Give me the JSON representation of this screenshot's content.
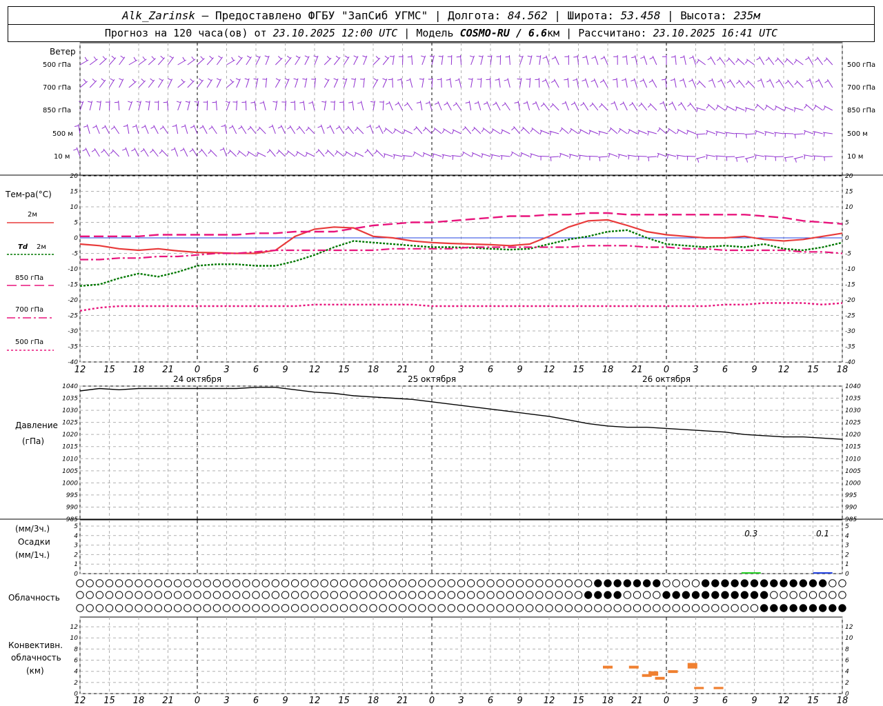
{
  "header": {
    "station": "Alk_Zarinsk",
    "provider": " – Предоставлено ФГБУ \"ЗапСиб УГМС\"",
    "lon_label": "Долгота:",
    "lon": "84.562",
    "lat_label": "Широта:",
    "lat": "53.458",
    "alt_label": "Высота:",
    "alt": "235м",
    "forecast_prefix": "Прогноз на 120 часа(ов) от",
    "forecast_time": "23.10.2025 12:00 UTC",
    "model_label": "Модель",
    "model": "COSMO-RU / 6.6",
    "model_unit": "км",
    "calc_label": "Рассчитано:",
    "calc_time": "23.10.2025 16:41 UTC"
  },
  "labels": {
    "wind": "Ветер",
    "wind_levels": [
      "500 гПа",
      "700 гПа",
      "850 гПа",
      "500 м",
      "10  м"
    ],
    "temp_title": "Тем-ра(°C)",
    "t2m": "2м",
    "td2m_a": "Td",
    "td2m_b": "2м",
    "t850": "850 гПа",
    "t700": "700 гПа",
    "t500": "500 гПа",
    "pressure_a": "Давление",
    "pressure_b": "(гПа)",
    "precip_a": "(мм/3ч.)",
    "precip_b": "Осадки",
    "precip_c": "(мм/1ч.)",
    "cloud": "Облачность",
    "conv_a": "Конвективн.",
    "conv_b": "облачность",
    "conv_c": "(км)"
  },
  "colors": {
    "t2m": "#e83a3a",
    "td2m": "#007800",
    "t850": "#e8147c",
    "t700": "#e8147c",
    "t500": "#e8147c",
    "wind": "#9030d0",
    "pressure": "#000000",
    "precip_3h": "#20cc20",
    "precip_1h": "#2040e0",
    "conv": "#f08030",
    "grid": "#b0b0b0"
  },
  "chart_data": {
    "type": "line",
    "time_ticks": [
      "12",
      "15",
      "18",
      "21",
      "0",
      "3",
      "6",
      "9",
      "12",
      "15",
      "18",
      "21",
      "0",
      "3",
      "6",
      "9",
      "12",
      "15",
      "18",
      "21",
      "0",
      "3",
      "6",
      "9",
      "12",
      "15",
      "18"
    ],
    "date_labels": [
      "24 октября",
      "25 октября",
      "26 октября"
    ],
    "temperature": {
      "ylim": [
        -40,
        20
      ],
      "ticks": [
        20,
        15,
        10,
        5,
        0,
        -5,
        -10,
        -15,
        -20,
        -25,
        -30,
        -35,
        -40
      ],
      "hours": [
        0,
        3,
        6,
        9,
        12,
        15,
        18,
        21,
        24,
        27,
        30,
        33,
        36,
        39,
        42,
        45,
        48,
        51,
        54,
        57,
        60,
        63,
        66,
        69,
        72,
        75,
        78,
        81,
        84,
        87,
        90,
        93,
        96,
        99,
        102,
        105,
        108,
        111,
        114,
        117
      ],
      "series": [
        {
          "name": "2м",
          "values": [
            -2,
            -2.5,
            -3.5,
            -4,
            -3.5,
            -4.2,
            -4.7,
            -4.8,
            -5,
            -5,
            -4,
            0.5,
            2.8,
            3.5,
            3.2,
            0.5,
            0,
            -1,
            -1.5,
            -1.8,
            -2,
            -2.2,
            -2.5,
            -2,
            0.5,
            3.5,
            5.5,
            5.8,
            4,
            2,
            1,
            0.5,
            0,
            0,
            0.5,
            -0.5,
            -1,
            -0.5,
            0.5,
            1.5
          ]
        },
        {
          "name": "Td 2м",
          "values": [
            -15.5,
            -15,
            -13,
            -11.5,
            -12.5,
            -11,
            -9,
            -8.5,
            -8.5,
            -9,
            -9,
            -7.5,
            -5.5,
            -3,
            -1,
            -1.5,
            -2,
            -2.5,
            -3,
            -3,
            -3.2,
            -3.5,
            -3.8,
            -3.5,
            -2,
            -0.5,
            0.5,
            2,
            2.5,
            0,
            -2,
            -2.5,
            -3,
            -2.5,
            -3,
            -2,
            -3.5,
            -4,
            -3,
            -1.5
          ]
        },
        {
          "name": "850 гПа",
          "values": [
            0.5,
            0.5,
            0.5,
            0.5,
            1,
            1,
            1,
            1,
            1,
            1.5,
            1.5,
            2,
            2,
            2,
            3,
            4,
            4.5,
            5,
            5,
            5.5,
            6,
            6.5,
            7,
            7,
            7.5,
            7.5,
            8,
            8,
            7.5,
            7.5,
            7.5,
            7.5,
            7.5,
            7.5,
            7.5,
            7,
            6.5,
            5.5,
            5,
            4.5
          ]
        },
        {
          "name": "700 гПа",
          "values": [
            -7,
            -7,
            -6.5,
            -6.5,
            -6,
            -6,
            -5.5,
            -5,
            -5,
            -4.5,
            -4,
            -4,
            -4,
            -4,
            -4,
            -4,
            -3.5,
            -3.5,
            -3.5,
            -3.5,
            -3,
            -3,
            -3,
            -3,
            -3,
            -3,
            -2.5,
            -2.5,
            -2.5,
            -3,
            -3,
            -3.5,
            -3.5,
            -4,
            -4,
            -4,
            -4,
            -4.5,
            -4.5,
            -5
          ]
        },
        {
          "name": "500 гПа",
          "values": [
            -23.5,
            -22.5,
            -22,
            -22,
            -22,
            -22,
            -22,
            -22,
            -22,
            -22,
            -22,
            -22,
            -21.5,
            -21.5,
            -21.5,
            -21.5,
            -21.5,
            -21.5,
            -22,
            -22,
            -22,
            -22,
            -22,
            -22,
            -22,
            -22,
            -22,
            -22,
            -22,
            -22,
            -22,
            -22,
            -22,
            -21.5,
            -21.5,
            -21,
            -21,
            -21,
            -21.5,
            -21
          ]
        }
      ]
    },
    "pressure": {
      "ylim": [
        985,
        1040
      ],
      "ticks": [
        1040,
        1035,
        1030,
        1025,
        1020,
        1015,
        1010,
        1005,
        1000,
        995,
        990,
        985
      ],
      "hours": [
        0,
        3,
        6,
        9,
        12,
        15,
        18,
        21,
        24,
        27,
        30,
        33,
        36,
        39,
        42,
        45,
        48,
        51,
        54,
        57,
        60,
        63,
        66,
        69,
        72,
        75,
        78,
        81,
        84,
        87,
        90,
        93,
        96,
        99,
        102,
        105,
        108,
        111,
        114,
        117
      ],
      "values": [
        1038,
        1039,
        1038.5,
        1039,
        1039,
        1039,
        1039,
        1039,
        1039,
        1039.5,
        1039.5,
        1038.5,
        1037.5,
        1037,
        1036,
        1035.5,
        1035,
        1034.5,
        1033.5,
        1032.5,
        1031.5,
        1030.5,
        1029.5,
        1028.5,
        1027.5,
        1026,
        1024.5,
        1023.5,
        1023,
        1023,
        1022.5,
        1022,
        1021.5,
        1021,
        1020,
        1019.5,
        1019,
        1019,
        1018.5,
        1018
      ]
    },
    "precipitation": {
      "ylim": [
        0,
        5
      ],
      "ticks": [
        5,
        4,
        3,
        2,
        1,
        0
      ],
      "bars": [
        {
          "hour": 103,
          "value": 0.3,
          "kind": "3h"
        },
        {
          "hour": 114,
          "value": 0.1,
          "kind": "1h"
        }
      ],
      "labels": [
        "0.3",
        "0.1"
      ]
    },
    "convective_cloud": {
      "ylim": [
        0,
        13
      ],
      "ticks": [
        12,
        10,
        8,
        6,
        4,
        2,
        0
      ],
      "segments": [
        {
          "hour": 81,
          "bottom": 4.5,
          "top": 5
        },
        {
          "hour": 85,
          "bottom": 4.5,
          "top": 5
        },
        {
          "hour": 87,
          "bottom": 3,
          "top": 3.5
        },
        {
          "hour": 88,
          "bottom": 3.2,
          "top": 4
        },
        {
          "hour": 89,
          "bottom": 2.5,
          "top": 3
        },
        {
          "hour": 91,
          "bottom": 3.7,
          "top": 4.2
        },
        {
          "hour": 94,
          "bottom": 4.5,
          "top": 5.5
        },
        {
          "hour": 95,
          "bottom": 0.8,
          "top": 1.2
        },
        {
          "hour": 98,
          "bottom": 0.8,
          "top": 1.2
        }
      ]
    }
  }
}
